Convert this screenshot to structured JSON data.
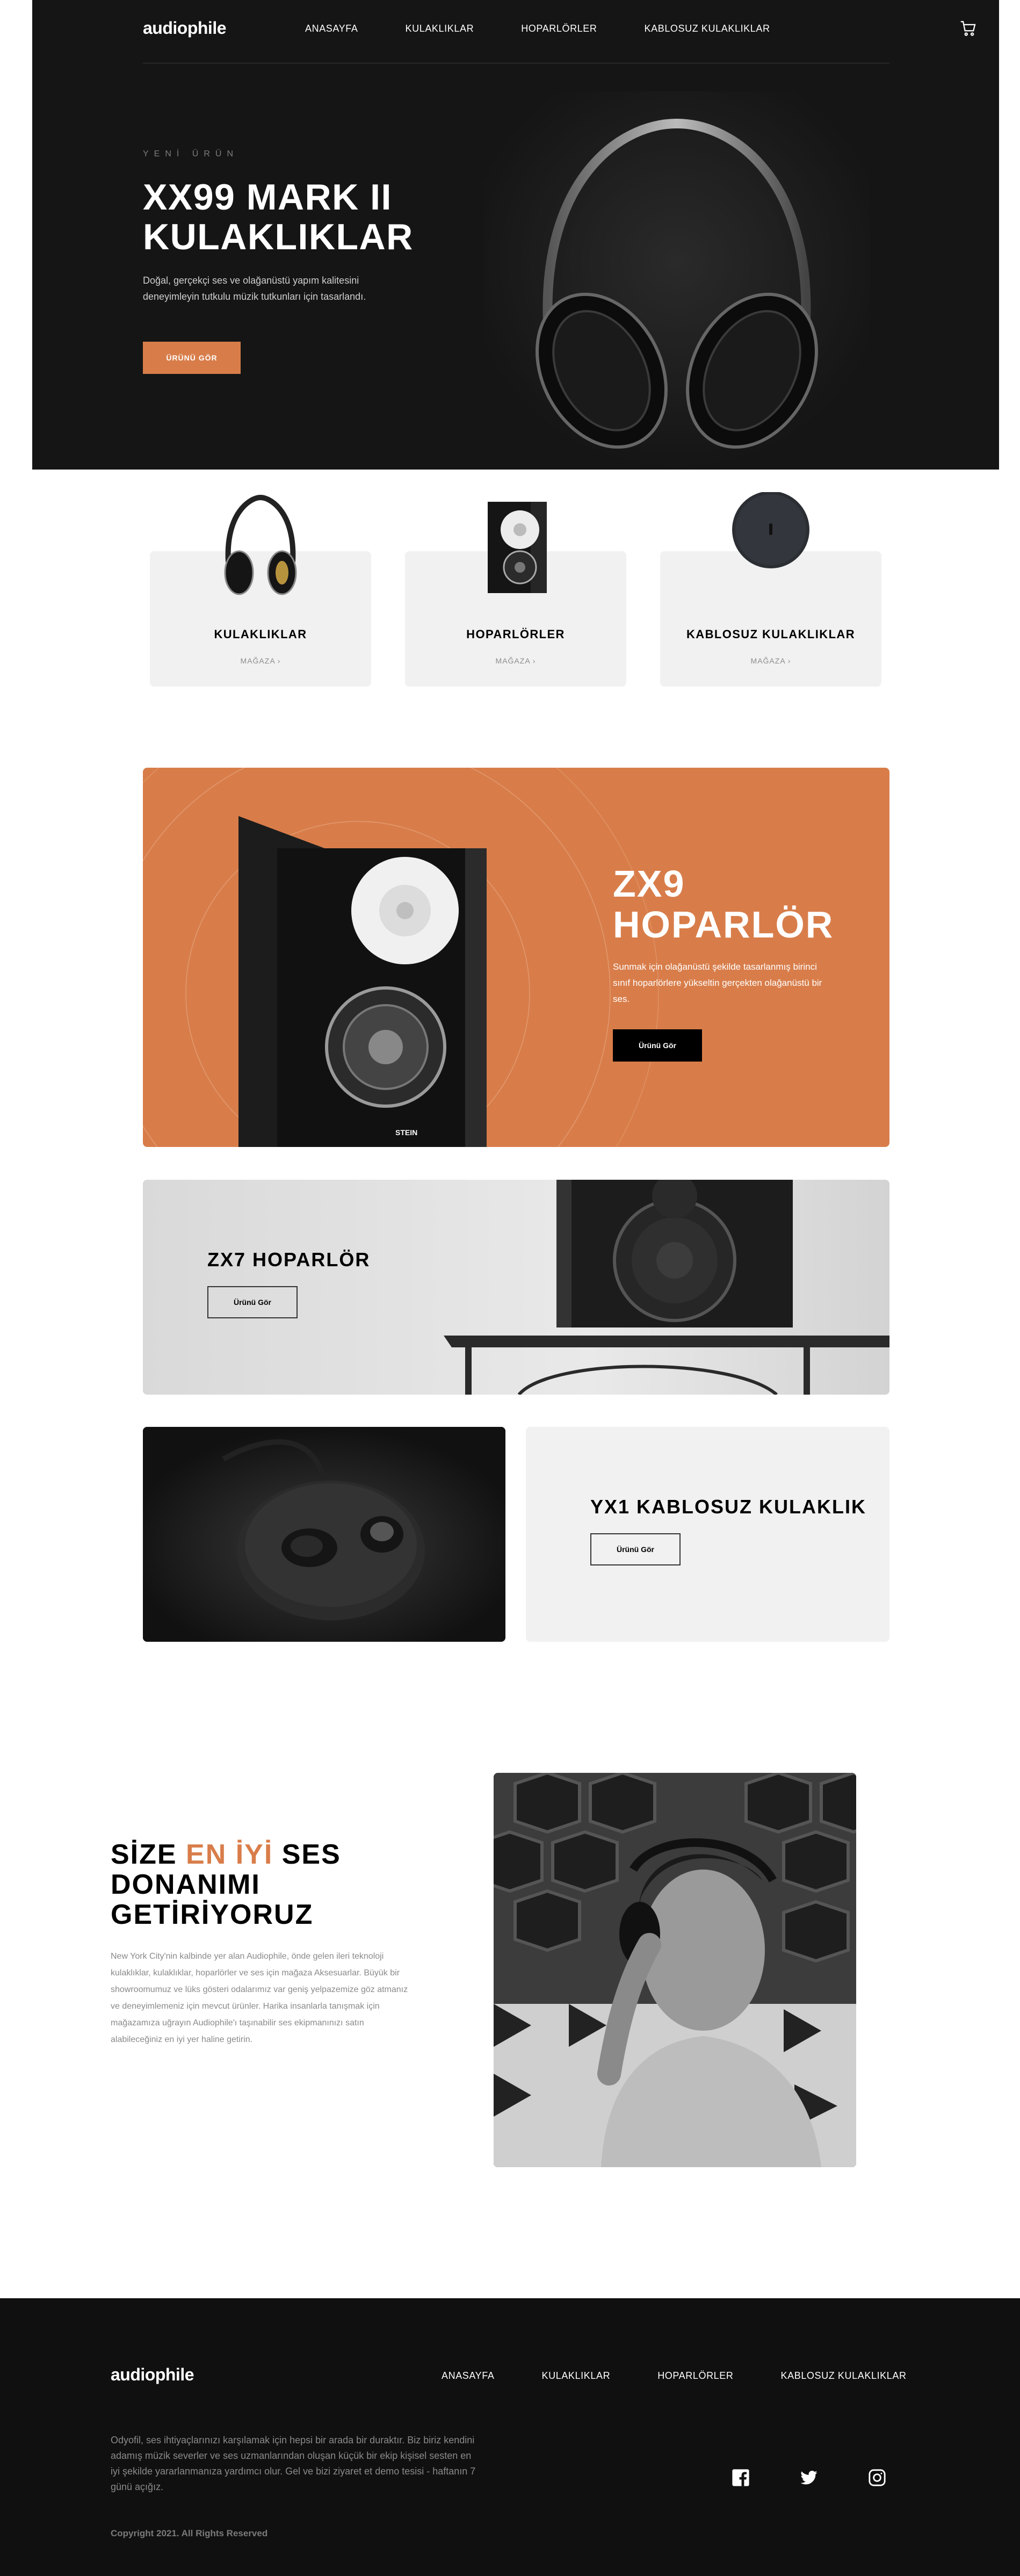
{
  "brand": "audiophile",
  "nav": {
    "links": [
      "ANASAYFA",
      "KULAKLIKLAR",
      "HOPARLÖRLER",
      "KABLOSUZ KULAKLIKLAR"
    ]
  },
  "hero": {
    "eyebrow": "YENİ ÜRÜN",
    "title_line1": "XX99 MARK II",
    "title_line2": "KULAKLIKLAR",
    "description": "Doğal, gerçekçi ses ve olağanüstü yapım kalitesini deneyimleyin tutkulu müzik tutkunları için tasarlandı.",
    "button": "ÜRÜNÜ GÖR"
  },
  "categories": [
    {
      "name": "KULAKLIKLAR",
      "shop": "MAĞAZA ›",
      "icon": "headphones-image"
    },
    {
      "name": "HOPARLÖRLER",
      "shop": "MAĞAZA ›",
      "icon": "speaker-image"
    },
    {
      "name": "KABLOSUZ KULAKLIKLAR",
      "shop": "MAĞAZA ›",
      "icon": "earphones-case-image"
    }
  ],
  "zx9": {
    "title_line1": "ZX9",
    "title_line2": "HOPARLÖR",
    "description": "Sunmak için olağanüstü şekilde tasarlanmış birinci sınıf hoparlörlere yükseltin gerçekten olağanüstü bir ses.",
    "button": "Ürünü Gör",
    "speaker_brand": "STEIN"
  },
  "zx7": {
    "title": "ZX7 HOPARLÖR",
    "button": "Ürünü Gör"
  },
  "yx1": {
    "title": "YX1 KABLOSUZ KULAKLIK",
    "button": "Ürünü Gör"
  },
  "about": {
    "title_part1": "SİZE ",
    "title_accent": "EN İYİ",
    "title_part2": " SES DONANIMI GETİRİYORUZ",
    "description": "New York City'nin kalbinde yer alan Audiophile, önde gelen ileri teknoloji kulaklıklar, kulaklıklar, hoparlörler ve ses için mağaza Aksesuarlar. Büyük bir showroomumuz ve lüks gösteri odalarımız var geniş yelpazemize göz atmanız ve deneyimlemeniz için mevcut ürünler. Harika insanlarla tanışmak için mağazamıza uğrayın Audiophile'ı taşınabilir ses ekipmanınızı satın alabileceğiniz en iyi yer haline getirin."
  },
  "footer": {
    "links": [
      "ANASAYFA",
      "KULAKLIKLAR",
      "HOPARLÖRLER",
      "KABLOSUZ KULAKLIKLAR"
    ],
    "description": "Odyofil, ses ihtiyaçlarınızı karşılamak için hepsi bir arada bir duraktır. Biz biriz kendini adamış müzik severler ve ses uzmanlarından oluşan küçük bir ekip kişisel sesten en iyi şekilde yararlanmanıza yardımcı olur. Gel ve bizi ziyaret et demo tesisi - haftanın 7 günü açığız.",
    "copyright": "Copyright 2021. All Rights Reserved",
    "social": [
      "facebook-icon",
      "twitter-icon",
      "instagram-icon"
    ]
  },
  "colors": {
    "accent": "#d87d4a",
    "dark": "#101010",
    "light_card": "#f1f1f1"
  }
}
